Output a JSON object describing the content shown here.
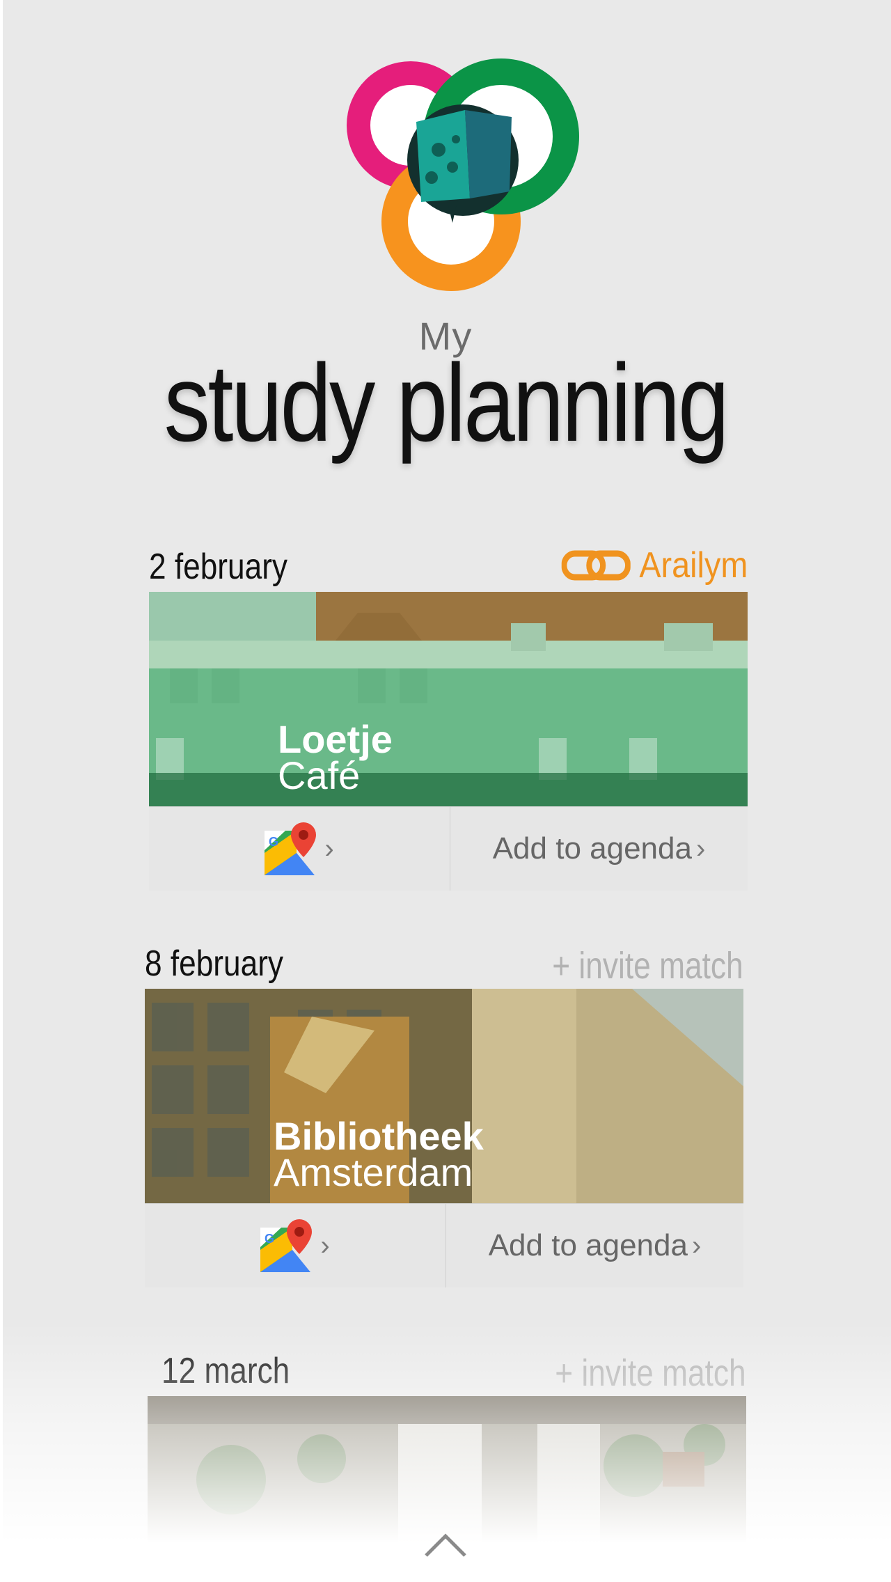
{
  "header": {
    "subtitle": "My",
    "title": "study planning"
  },
  "sessions": [
    {
      "date": "2 february",
      "match_name": "Arailym",
      "venue_name": "Loetje",
      "venue_sub": "Café",
      "agenda_label": "Add to agenda",
      "chevron": "›"
    },
    {
      "date": "8 february",
      "invite_label": "+ invite match",
      "venue_name": "Bibliotheek",
      "venue_sub": "Amsterdam",
      "agenda_label": "Add to agenda",
      "chevron": "›"
    },
    {
      "date": "12 march",
      "invite_label": "+ invite match"
    }
  ],
  "colors": {
    "accent_orange": "#f0931f",
    "ring_pink": "#e51e7b",
    "ring_green": "#0b9447",
    "ring_orange": "#f7931e"
  },
  "icons": [
    "app-logo",
    "link-icon",
    "google-maps-icon",
    "chevron-right-icon",
    "chevron-up-icon"
  ]
}
